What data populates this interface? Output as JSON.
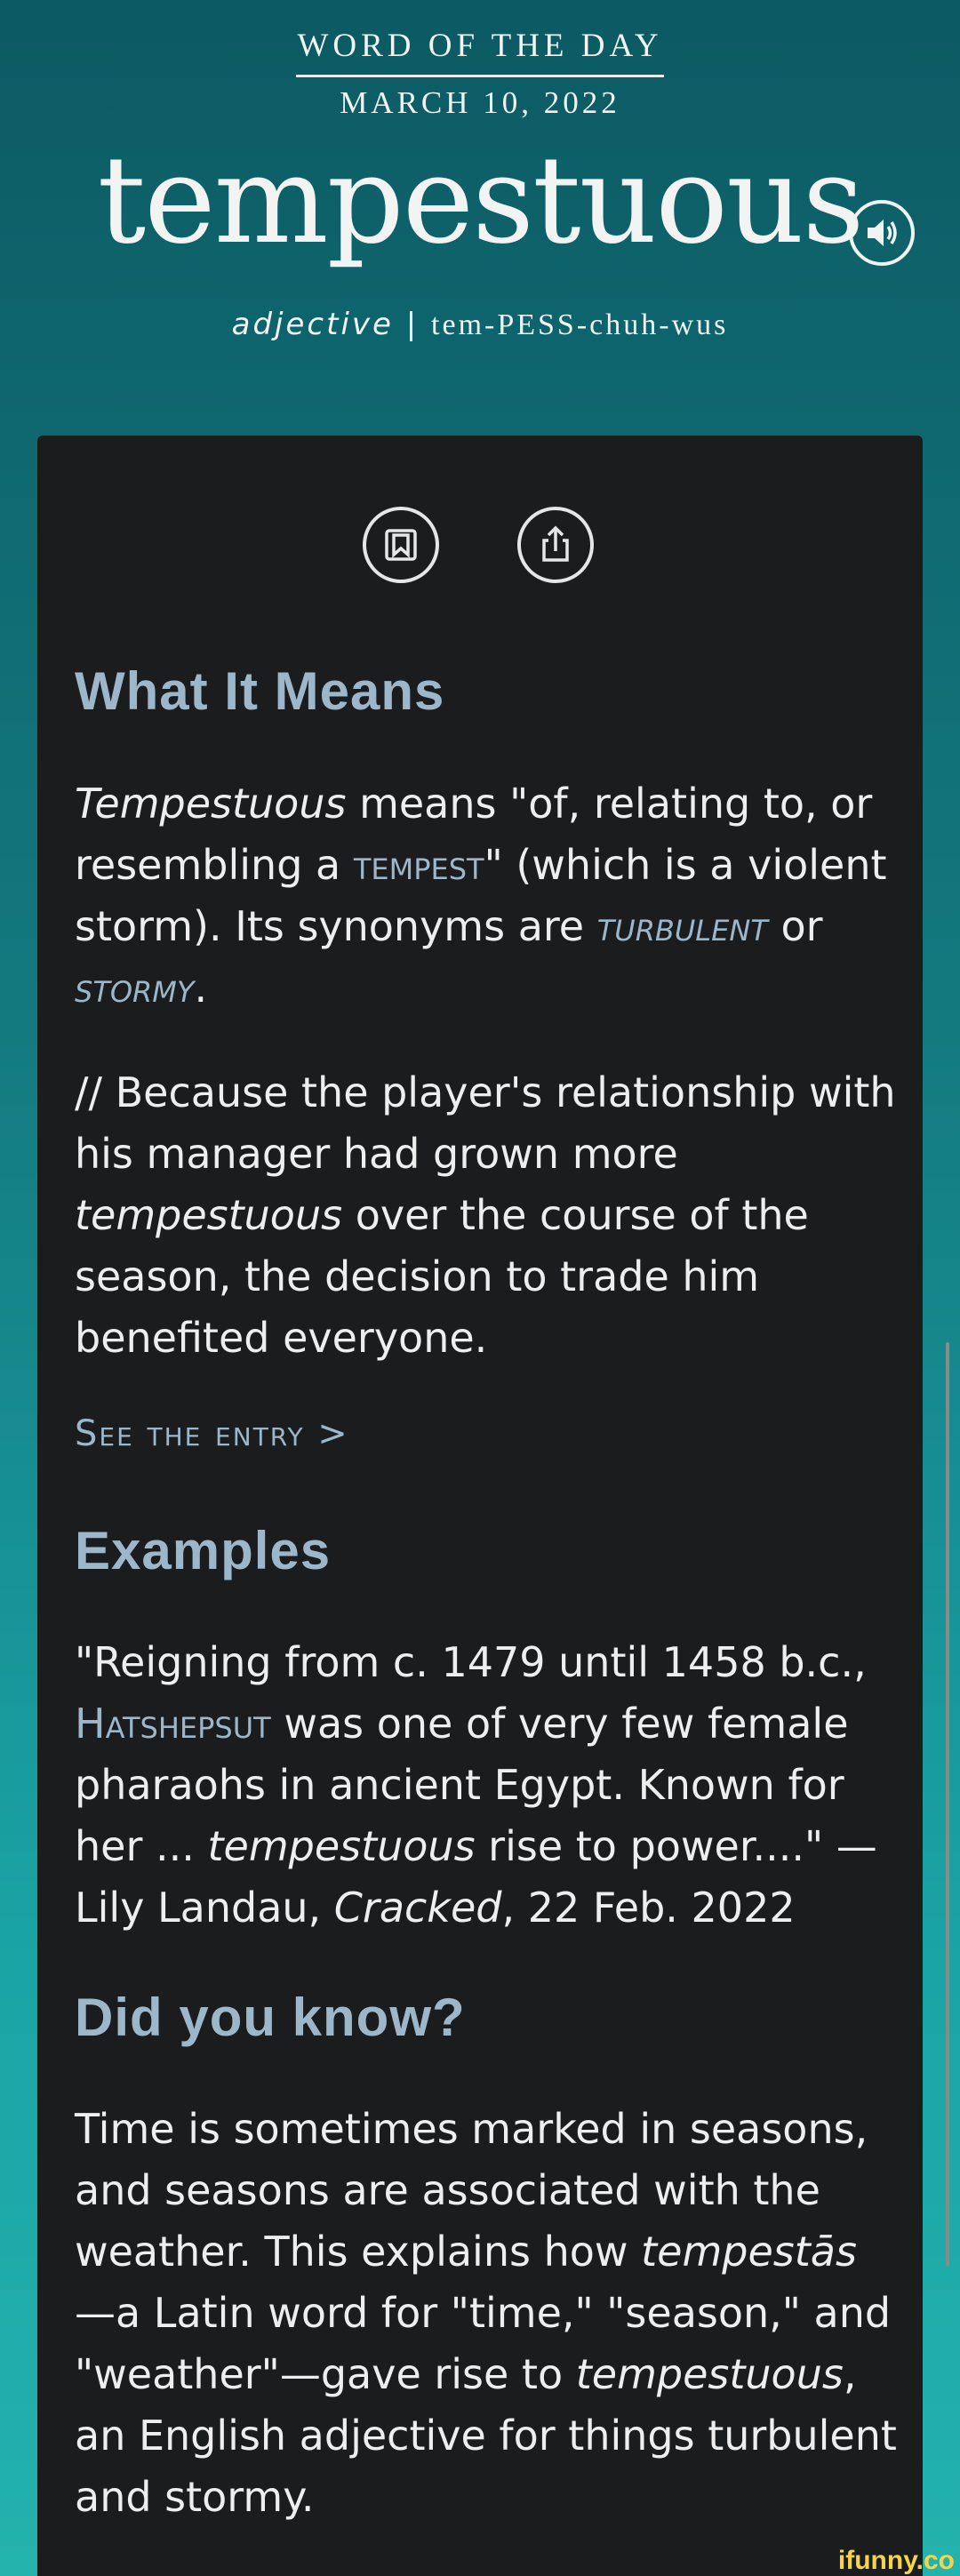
{
  "header": {
    "label": "WORD OF THE DAY",
    "date": "MARCH 10, 2022",
    "word": "tempestuous",
    "part_of_speech": "adjective",
    "separator": "|",
    "pronunciation": "tem-PESS-chuh-wus"
  },
  "icons": {
    "speaker": "speaker-icon",
    "bookmark": "bookmark-icon",
    "share": "share-icon"
  },
  "what_it_means": {
    "heading": "What It Means",
    "p1": {
      "word": "Tempestuous",
      "t1": " means \"of, relating to, or resembling a ",
      "link_tempest": "tempest",
      "t2": "\" (which is a violent storm). Its synonyms are ",
      "link_turbulent": "turbulent",
      "t3": " or ",
      "link_stormy": "stormy",
      "t4": "."
    },
    "p2": {
      "t1": "// Because the player's relationship with his manager had grown more ",
      "word": "tempestuous",
      "t2": " over the course of the season, the decision to trade him benefited everyone."
    },
    "see_entry": "See the entry >"
  },
  "examples": {
    "heading": "Examples",
    "t1": "\"Reigning from c. 1479 until 1458 b.c., ",
    "link_hatshepsut": "Hatshepsut",
    "t2": " was one of very few female pharaohs in ancient Egypt. Known for her ... ",
    "word": "tempestuous",
    "t3": " rise to power....\" — Lily Landau, ",
    "source": "Cracked",
    "t4": ", 22 Feb. 2022"
  },
  "did_you_know": {
    "heading": "Did you know?",
    "t1": "Time is sometimes marked in seasons, and seasons are associated with the weather. This explains how ",
    "latin": "tempestās",
    "t2": " —a Latin word for \"time,\" \"season,\" and \"weather\"—gave rise to ",
    "word": "tempestuous",
    "t3": ", an English adjective for things turbulent and stormy."
  },
  "watermark": "ifunny.co",
  "colors": {
    "accent": "#9cb7c9",
    "card": "#1b1c1e",
    "bg_top": "#0c5a63",
    "bg_bottom": "#24b2ad"
  }
}
